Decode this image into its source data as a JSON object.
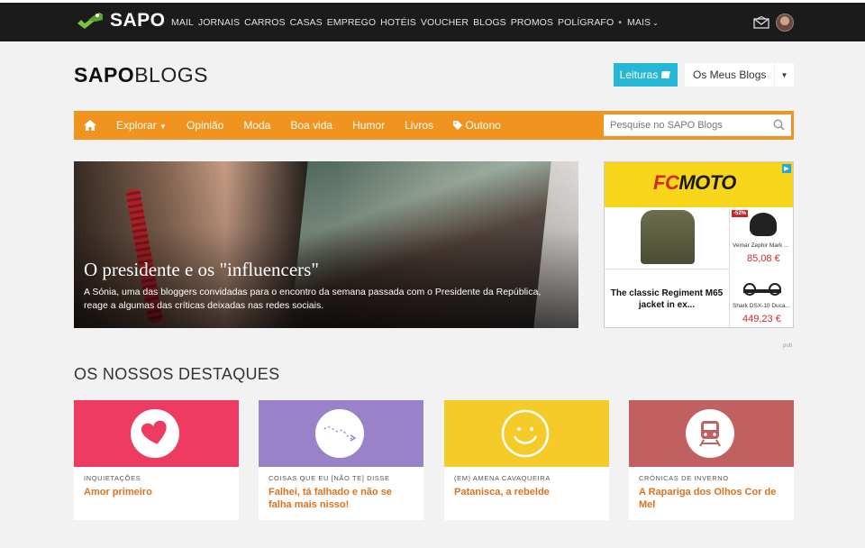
{
  "topbar": {
    "logo_text": "SAPO",
    "nav": [
      "MAIL",
      "JORNAIS",
      "CARROS",
      "CASAS",
      "EMPREGO",
      "HOTÉIS",
      "VOUCHER",
      "BLOGS",
      "PROMOS",
      "POLÍGRAFO",
      "•",
      "MAIS"
    ]
  },
  "header": {
    "brand_bold": "SAPO",
    "brand_light": "BLOGS",
    "leituras_label": "Leituras",
    "meus_blogs_label": "Os Meus Blogs"
  },
  "mainnav": {
    "items": [
      "Explorar",
      "Opinião",
      "Moda",
      "Boa vida",
      "Humor",
      "Livros",
      "Outono"
    ],
    "search_placeholder": "Pesquise no SAPO Blogs"
  },
  "hero": {
    "title": "O presidente e os \"influencers\"",
    "text": "A Sónia, uma das bloggers convidadas para o encontro da semana passada com o Presidente da República, reage a algumas das críticas deixadas nas redes sociais."
  },
  "ad": {
    "logo_fc": "FC",
    "logo_moto": "MOTO",
    "left_text": "The classic Regiment M65 jacket in ex...",
    "badge": "-52%",
    "product1_name": "Vemar Zephir Mark ...",
    "product1_price": "85,08 €",
    "product2_name": "Shark DSX-10 Duca...",
    "product2_price": "449,23 €",
    "pub": "pub"
  },
  "destaques": {
    "title": "OS NOSSOS DESTAQUES",
    "cards": [
      {
        "category": "INQUIETAÇÕES",
        "title": "Amor primeiro",
        "color": "#ee3b61"
      },
      {
        "category": "COISAS QUE EU [NÃO TE] DISSE",
        "title": "Falhei, tá falhado e não se falha mais nisso!",
        "color": "#9a82c9"
      },
      {
        "category": "(EM) AMENA CAVAQUEIRA",
        "title": "Patanisca, a rebelde",
        "color": "#f5cb2a"
      },
      {
        "category": "CRÓNICAS DE INVERNO",
        "title": "A Rapariga dos Olhos Cor de Mel",
        "color": "#c16060"
      }
    ]
  },
  "colors": {
    "orange": "#f0931f",
    "leituras": "#27b7d6",
    "title_orange": "#e0711b"
  }
}
